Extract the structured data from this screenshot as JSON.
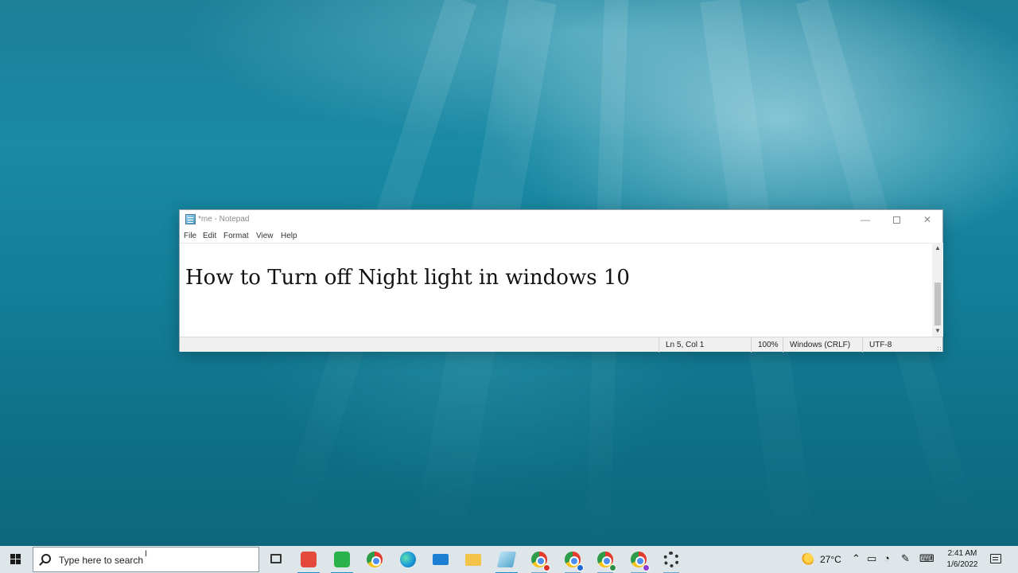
{
  "notepad": {
    "title": "*me - Notepad",
    "menu": [
      "File",
      "Edit",
      "Format",
      "View",
      "Help"
    ],
    "content": "How to Turn off Night light in windows 10",
    "controls": {
      "minimize": "—",
      "maximize": "",
      "close": "✕"
    },
    "statusbar": {
      "position": "Ln 5, Col 1",
      "zoom": "100%",
      "line_ending": "Windows (CRLF)",
      "encoding": "UTF-8"
    }
  },
  "taskbar": {
    "search_placeholder": "Type here to search",
    "apps": [
      {
        "name": "task-view",
        "icon": "task-view-icon"
      },
      {
        "name": "app-red",
        "icon": "red-app-icon",
        "color": "#e44a3c"
      },
      {
        "name": "app-green",
        "icon": "green-app-icon",
        "color": "#2ab34a"
      },
      {
        "name": "chrome",
        "icon": "chrome-icon"
      },
      {
        "name": "edge",
        "icon": "edge-icon"
      },
      {
        "name": "mail",
        "icon": "mail-icon"
      },
      {
        "name": "file-explorer",
        "icon": "folder-icon"
      },
      {
        "name": "notepad",
        "icon": "notepad-icon"
      },
      {
        "name": "chrome-profile-1",
        "icon": "chrome-icon"
      },
      {
        "name": "chrome-profile-2",
        "icon": "chrome-icon"
      },
      {
        "name": "chrome-profile-3",
        "icon": "chrome-icon"
      },
      {
        "name": "chrome-profile-4",
        "icon": "chrome-icon"
      },
      {
        "name": "settings",
        "icon": "gear-icon"
      }
    ],
    "tray": {
      "temperature": "27°C",
      "time": "2:41 AM",
      "date": "1/6/2022"
    }
  }
}
